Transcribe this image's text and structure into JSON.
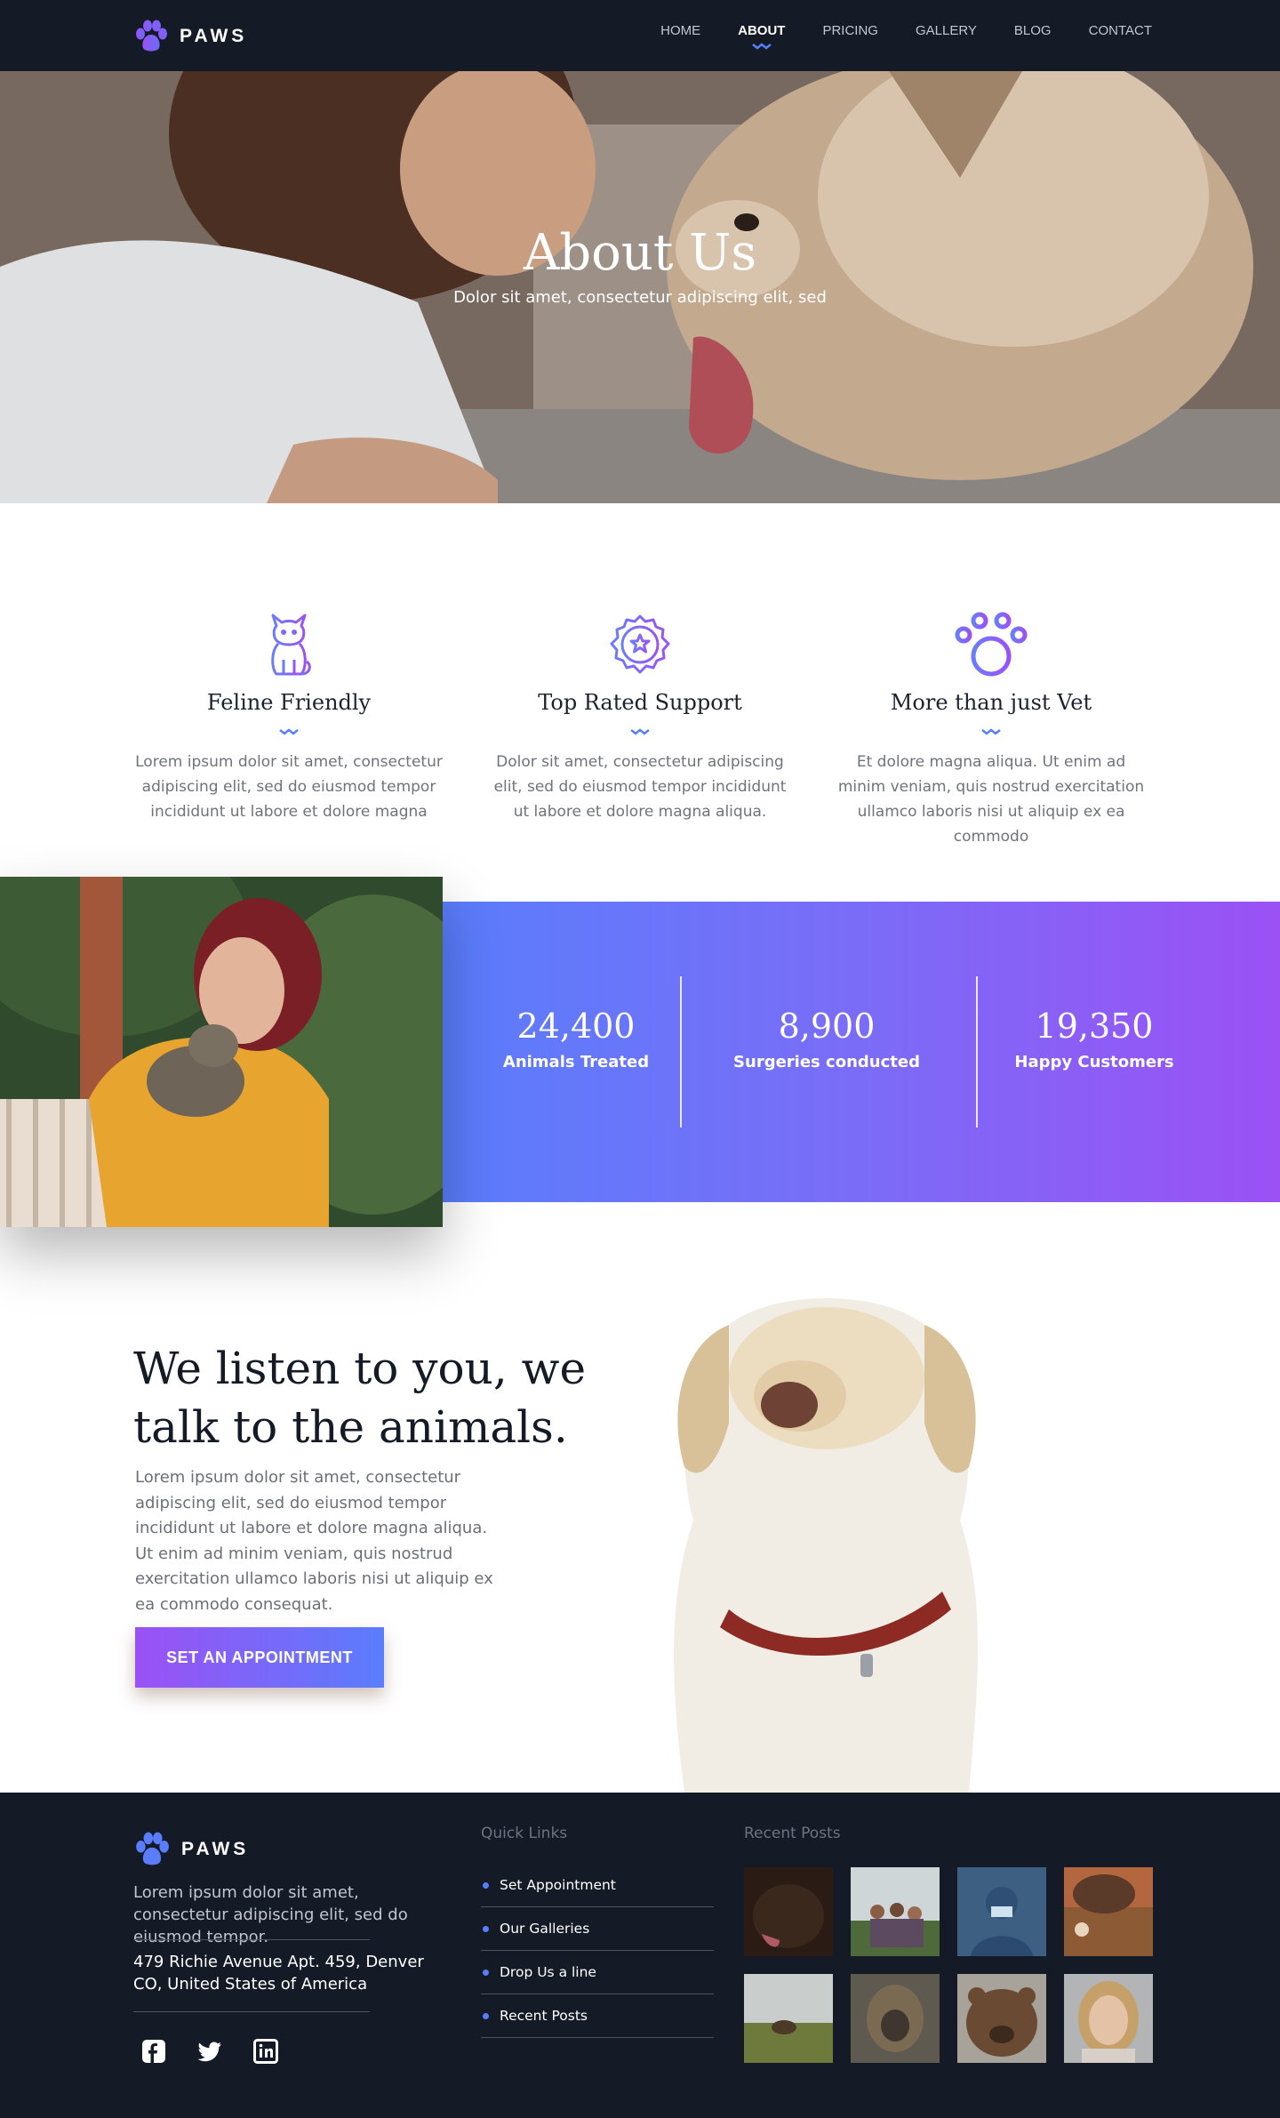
{
  "nav": {
    "brand": "PAWS",
    "items": [
      {
        "label": "HOME"
      },
      {
        "label": "ABOUT",
        "active": true
      },
      {
        "label": "PRICING"
      },
      {
        "label": "GALLERY"
      },
      {
        "label": "BLOG"
      },
      {
        "label": "CONTACT"
      }
    ]
  },
  "hero": {
    "title": "About Us",
    "subtitle": "Dolor sit amet, consectetur adipiscing elit, sed"
  },
  "features": [
    {
      "icon": "cat-icon",
      "title": "Feline Friendly",
      "text": "Lorem ipsum dolor sit amet, consectetur adipiscing elit, sed do eiusmod tempor incididunt ut labore et dolore magna"
    },
    {
      "icon": "star-badge-icon",
      "title": "Top Rated Support",
      "text": "Dolor sit amet, consectetur adipiscing elit, sed do eiusmod tempor incididunt ut labore et dolore magna aliqua."
    },
    {
      "icon": "paw-print-icon",
      "title": "More than just Vet",
      "text": "Et dolore magna aliqua. Ut enim ad minim veniam, quis nostrud exercitation ullamco laboris nisi ut aliquip ex ea commodo"
    }
  ],
  "stats": [
    {
      "value": "24,400",
      "label": "Animals Treated"
    },
    {
      "value": "8,900",
      "label": "Surgeries conducted"
    },
    {
      "value": "19,350",
      "label": "Happy Customers"
    }
  ],
  "listen": {
    "title_line1": "We listen to you, we",
    "title_line2": "talk to the animals.",
    "text": "Lorem ipsum dolor sit amet, consectetur adipiscing elit, sed do eiusmod tempor incididunt ut labore et dolore magna aliqua. Ut enim ad minim veniam, quis nostrud exercitation ullamco laboris nisi ut aliquip ex ea commodo consequat.",
    "cta": "SET AN APPOINTMENT"
  },
  "footer": {
    "brand": "PAWS",
    "description": "Lorem ipsum dolor sit amet, consectetur adipiscing elit, sed do eiusmod tempor.",
    "address_line1": "479 Richie Avenue Apt. 459, Denver",
    "address_line2": "CO, United States of America",
    "quick_links_heading": "Quick Links",
    "quick_links": [
      "Set Appointment",
      "Our Galleries",
      "Drop Us a line",
      "Recent Posts"
    ],
    "recent_posts_heading": "Recent Posts",
    "socials": [
      "facebook-icon",
      "twitter-icon",
      "linkedin-icon"
    ]
  },
  "colors": {
    "nav_bg": "#141b26",
    "accent_blue": "#5a7dfc",
    "accent_purple": "#9b51f5",
    "heading_dark": "#1b2230",
    "body_text": "#6b6f7a"
  }
}
